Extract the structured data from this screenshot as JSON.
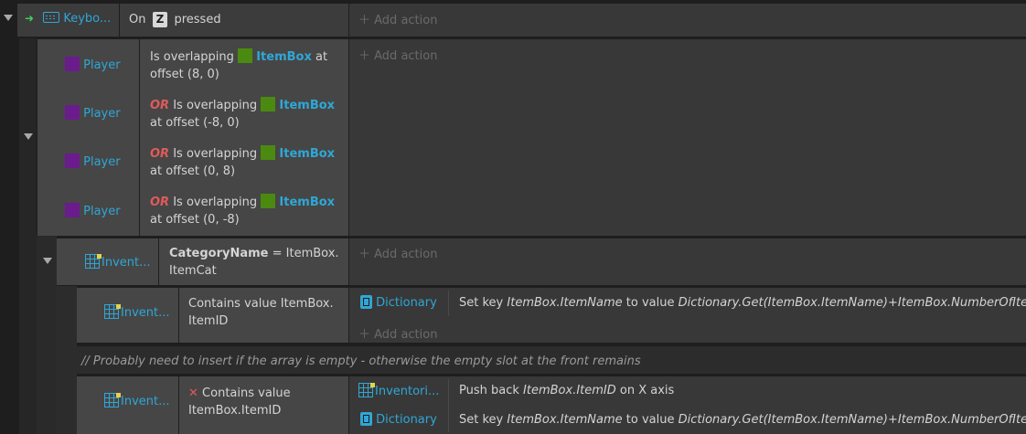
{
  "root": {
    "trigger_object": "Keybo...",
    "trigger_on": "On",
    "trigger_key": "Z",
    "trigger_pressed": "pressed",
    "add_action": "Add action"
  },
  "overlap_block": {
    "conditions": [
      {
        "object": "Player",
        "or": "",
        "line1_pre": "Is overlapping",
        "target": "ItemBox",
        "line1_post": "at",
        "line2": "offset (8, 0)"
      },
      {
        "object": "Player",
        "or": "OR",
        "line1_pre": "Is overlapping",
        "target": "ItemBox",
        "line1_post": "",
        "line2": "at offset (-8, 0)"
      },
      {
        "object": "Player",
        "or": "OR",
        "line1_pre": "Is overlapping",
        "target": "ItemBox",
        "line1_post": "",
        "line2": "at offset (0, 8)"
      },
      {
        "object": "Player",
        "or": "OR",
        "line1_pre": "Is overlapping",
        "target": "ItemBox",
        "line1_post": "",
        "line2": "at offset (0, -8)"
      }
    ],
    "add_action": "Add action"
  },
  "category_block": {
    "object": "Invent...",
    "var": "CategoryName",
    "eq": "= ItemBox.",
    "line2": "ItemCat",
    "add_action": "Add action"
  },
  "contains_block": {
    "object": "Invent...",
    "line1": "Contains value ItemBox.",
    "line2": "ItemID",
    "action_object": "Dictionary",
    "action_pre": "Set key",
    "action_key": "ItemBox.ItemName",
    "action_mid": "to value",
    "action_value": "Dictionary.Get(ItemBox.ItemName)+ItemBox.NumberOfItems",
    "add_action": "Add action"
  },
  "comment": "//  Probably need to insert if the array is empty - otherwise the empty slot at the front remains",
  "not_contains_block": {
    "object": "Invent...",
    "invert_mark": "✕",
    "line1": "Contains value",
    "line2": "ItemBox.ItemID",
    "actions": [
      {
        "object": "Inventori...",
        "pre": "Push back",
        "key": "ItemBox.ItemID",
        "mid": "on X axis",
        "value": ""
      },
      {
        "object": "Dictionary",
        "pre": "Set key",
        "key": "ItemBox.ItemName",
        "mid": "to value",
        "value": "Dictionary.Get(ItemBox.ItemName)+ItemBox.NumberOfItems"
      }
    ]
  },
  "colors": {
    "accent": "#2fa7d6",
    "or_keyword": "#e05a5a",
    "player_swatch": "#6b1c8c",
    "itembox_swatch": "#4b8a10"
  }
}
